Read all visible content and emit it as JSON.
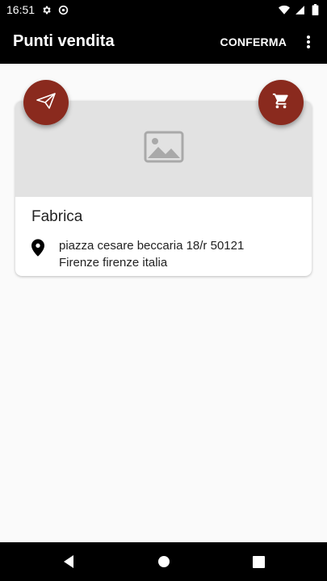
{
  "status_bar": {
    "time": "16:51",
    "icons": [
      "gear-icon",
      "sync-icon",
      "wifi-icon",
      "signal-icon",
      "battery-icon"
    ]
  },
  "app_bar": {
    "title": "Punti vendita",
    "confirm_label": "CONFERMA",
    "more_icon": "more-vert-icon"
  },
  "store_card": {
    "image_icon": "image-placeholder-icon",
    "name": "Fabrica",
    "address_line1": "piazza cesare beccaria 18/r 50121",
    "address_line2": "Firenze firenze italia",
    "pin_icon": "location-pin-icon"
  },
  "fabs": {
    "send_icon": "send-icon",
    "cart_icon": "cart-icon",
    "color": "#8a2a1e"
  },
  "nav_bar": {
    "icons": [
      "back-icon",
      "home-icon",
      "recents-icon"
    ]
  }
}
